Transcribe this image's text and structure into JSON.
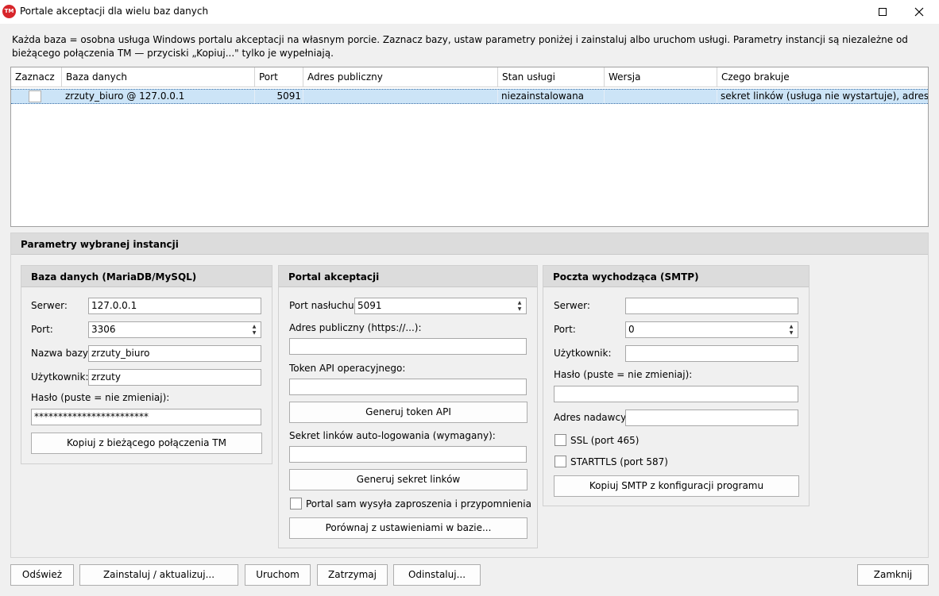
{
  "window": {
    "icon_text": "TM",
    "title": "Portale akceptacji dla wielu baz danych",
    "maximize_icon": "maximize-icon",
    "close_icon": "close-icon"
  },
  "description": "Każda baza = osobna usługa Windows portalu akceptacji na własnym porcie. Zaznacz bazy, ustaw parametry poniżej i zainstaluj albo uruchom usługi. Parametry instancji są niezależne od bieżącego połączenia TM — przyciski „Kopiuj...\" tylko je wypełniają.",
  "table": {
    "columns": [
      "Zaznacz",
      "Baza danych",
      "Port",
      "Adres publiczny",
      "Stan usługi",
      "Wersja",
      "Czego brakuje"
    ],
    "rows": [
      {
        "checked": false,
        "database": "zrzuty_biuro @ 127.0.0.1",
        "port": "5091",
        "public_address": "",
        "service_state": "niezainstalowana",
        "version": "",
        "missing": "sekret linków (usługa nie wystartuje), adres portalu"
      }
    ]
  },
  "params": {
    "title": "Parametry wybranej instancji",
    "db": {
      "title": "Baza danych (MariaDB/MySQL)",
      "server_label": "Serwer:",
      "server_value": "127.0.0.1",
      "port_label": "Port:",
      "port_value": "3306",
      "dbname_label": "Nazwa bazy:",
      "dbname_value": "zrzuty_biuro",
      "user_label": "Użytkownik:",
      "user_value": "zrzuty",
      "password_label": "Hasło (puste = nie zmieniaj):",
      "password_value": "************************",
      "copy_button": "Kopiuj z bieżącego połączenia TM"
    },
    "portal": {
      "title": "Portal akceptacji",
      "port_label": "Port nasłuchu:",
      "port_value": "5091",
      "public_label": "Adres publiczny (https://...):",
      "public_value": "",
      "token_label": "Token API operacyjnego:",
      "token_value": "",
      "gen_token_button": "Generuj token API",
      "secret_label": "Sekret linków auto-logowania (wymagany):",
      "secret_value": "",
      "gen_secret_button": "Generuj sekret linków",
      "sends_invites_label": "Portal sam wysyła zaproszenia i przypomnienia",
      "sends_invites_checked": false,
      "compare_button": "Porównaj z ustawieniami w bazie..."
    },
    "smtp": {
      "title": "Poczta wychodząca (SMTP)",
      "server_label": "Serwer:",
      "server_value": "",
      "port_label": "Port:",
      "port_value": "0",
      "user_label": "Użytkownik:",
      "user_value": "",
      "password_label": "Hasło (puste = nie zmieniaj):",
      "password_value": "",
      "sender_label": "Adres nadawcy:",
      "sender_value": "",
      "ssl_label": "SSL (port 465)",
      "ssl_checked": false,
      "starttls_label": "STARTTLS (port 587)",
      "starttls_checked": false,
      "copy_button": "Kopiuj SMTP z konfiguracji programu"
    }
  },
  "buttons": {
    "refresh": "Odśwież",
    "install": "Zainstaluj / aktualizuj...",
    "start": "Uruchom",
    "stop": "Zatrzymaj",
    "uninstall": "Odinstaluj...",
    "close": "Zamknij"
  }
}
